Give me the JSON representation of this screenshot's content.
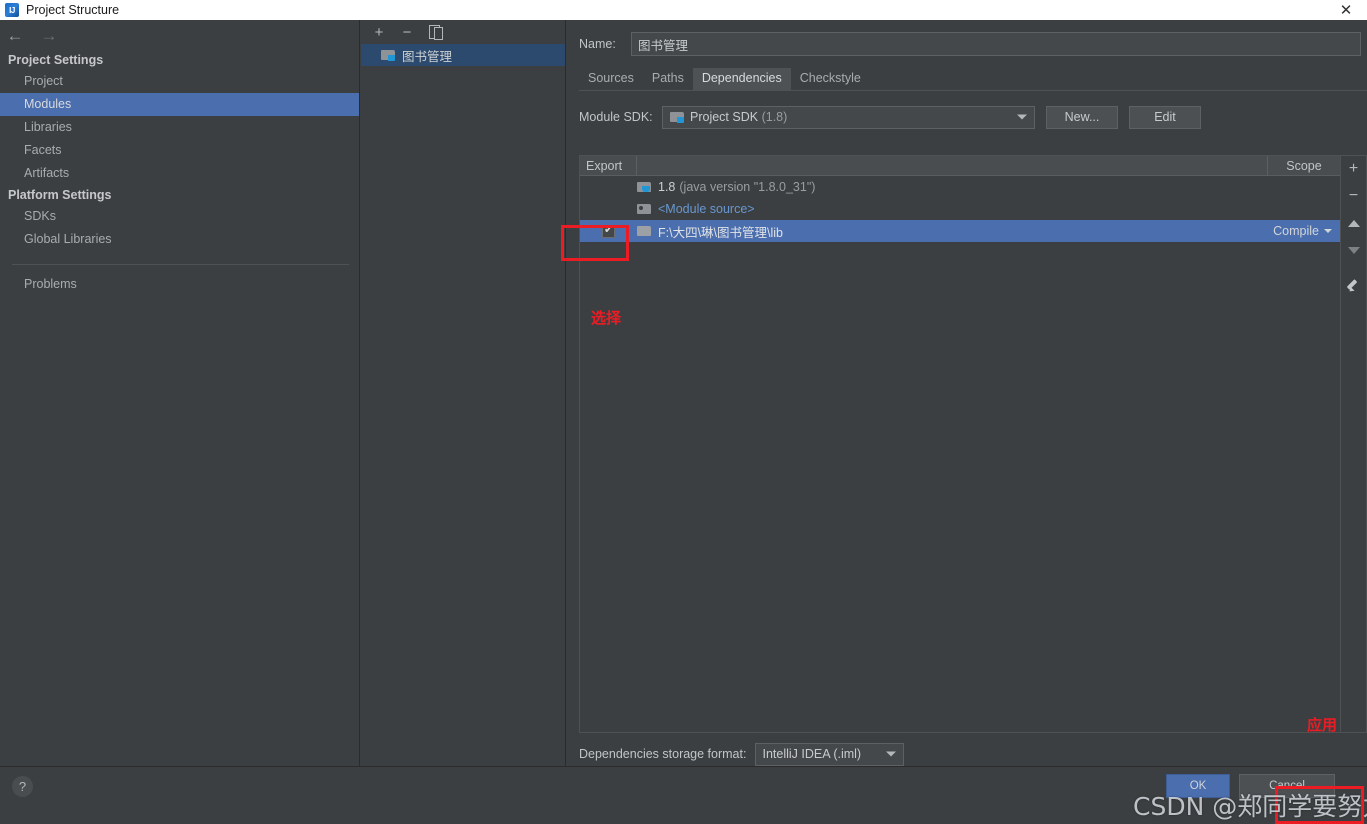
{
  "window": {
    "title": "Project Structure",
    "logo_text": "IJ",
    "close_icon": "close-icon"
  },
  "sidebar": {
    "back_icon": "←",
    "forward_icon": "→",
    "sections": [
      {
        "heading": "Project Settings",
        "items": [
          {
            "label": "Project",
            "selected": false
          },
          {
            "label": "Modules",
            "selected": true
          },
          {
            "label": "Libraries",
            "selected": false
          },
          {
            "label": "Facets",
            "selected": false
          },
          {
            "label": "Artifacts",
            "selected": false
          }
        ]
      },
      {
        "heading": "Platform Settings",
        "items": [
          {
            "label": "SDKs",
            "selected": false
          },
          {
            "label": "Global Libraries",
            "selected": false
          }
        ]
      }
    ],
    "problems_label": "Problems"
  },
  "modules_panel": {
    "toolbar": {
      "add_label": "+",
      "remove_label": "−",
      "copy_label": "copy-icon"
    },
    "modules": [
      {
        "name": "图书管理",
        "selected": true
      }
    ]
  },
  "content": {
    "name_label": "Name:",
    "name_value": "图书管理",
    "name_placeholder": "",
    "tabs": [
      {
        "label": "Sources",
        "active": false
      },
      {
        "label": "Paths",
        "active": false
      },
      {
        "label": "Dependencies",
        "active": true
      },
      {
        "label": "Checkstyle",
        "active": false
      }
    ],
    "sdk_label": "Module SDK:",
    "sdk_value": "Project SDK",
    "sdk_value_dim": "(1.8)",
    "buttons": {
      "new": "New...",
      "edit": "Edit"
    },
    "table": {
      "columns": {
        "export": "Export",
        "scope": "Scope"
      },
      "rows": [
        {
          "icon": "sdk-folder-icon",
          "checked": false,
          "show_checkbox": false,
          "label": "1.8",
          "label_dim": "(java version \"1.8.0_31\")",
          "scope": "",
          "selected": false,
          "link": false
        },
        {
          "icon": "module-source-icon",
          "checked": false,
          "show_checkbox": false,
          "label": "<Module source>",
          "label_dim": "",
          "scope": "",
          "selected": false,
          "link": true
        },
        {
          "icon": "library-folder-icon",
          "checked": true,
          "show_checkbox": true,
          "label": "F:\\大四\\琳\\图书管理\\lib",
          "label_dim": "",
          "scope": "Compile",
          "selected": true,
          "link": false
        }
      ],
      "side_buttons": [
        {
          "name": "add-dependency-button",
          "glyph": "+"
        },
        {
          "name": "remove-dependency-button",
          "glyph": "−"
        },
        {
          "name": "move-up-button",
          "glyph": "▲"
        },
        {
          "name": "move-down-button",
          "glyph": "▼"
        },
        {
          "name": "edit-dependency-button",
          "glyph": "pencil"
        }
      ]
    },
    "storage_label": "Dependencies storage format:",
    "storage_value": "IntelliJ IDEA (.iml)"
  },
  "bottom_bar": {
    "help_label": "?",
    "ok_label": "OK",
    "cancel_label": "Cancel"
  },
  "annotations": {
    "select_text": "选择",
    "apply_text": "应用",
    "color": "#ec1c24"
  },
  "watermark": {
    "text": "CSDN @郑同学要努力"
  }
}
